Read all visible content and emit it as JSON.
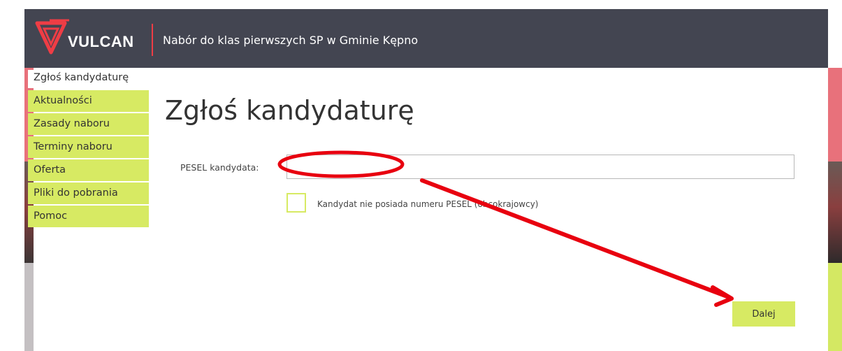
{
  "brand": {
    "name": "VULCAN",
    "accent_color": "#ef3d45"
  },
  "header": {
    "app_title": "Nabór do klas pierwszych SP w Gminie Kępno"
  },
  "sidebar": {
    "items": [
      {
        "label": "Zgłoś kandydaturę",
        "active": true
      },
      {
        "label": "Aktualności"
      },
      {
        "label": "Zasady naboru"
      },
      {
        "label": "Terminy naboru"
      },
      {
        "label": "Oferta"
      },
      {
        "label": "Pliki do pobrania"
      },
      {
        "label": "Pomoc"
      }
    ]
  },
  "main": {
    "title": "Zgłoś kandydaturę",
    "pesel": {
      "label": "PESEL kandydata:",
      "value": ""
    },
    "no_pesel_checkbox": {
      "label": "Kandydat nie posiada numeru PESEL (obcokrajowcy)",
      "checked": false
    },
    "next_button": {
      "label": "Dalej"
    }
  },
  "colors": {
    "topbar": "#434551",
    "menu_green": "#d7ea63",
    "annotation_red": "#e8000f"
  }
}
